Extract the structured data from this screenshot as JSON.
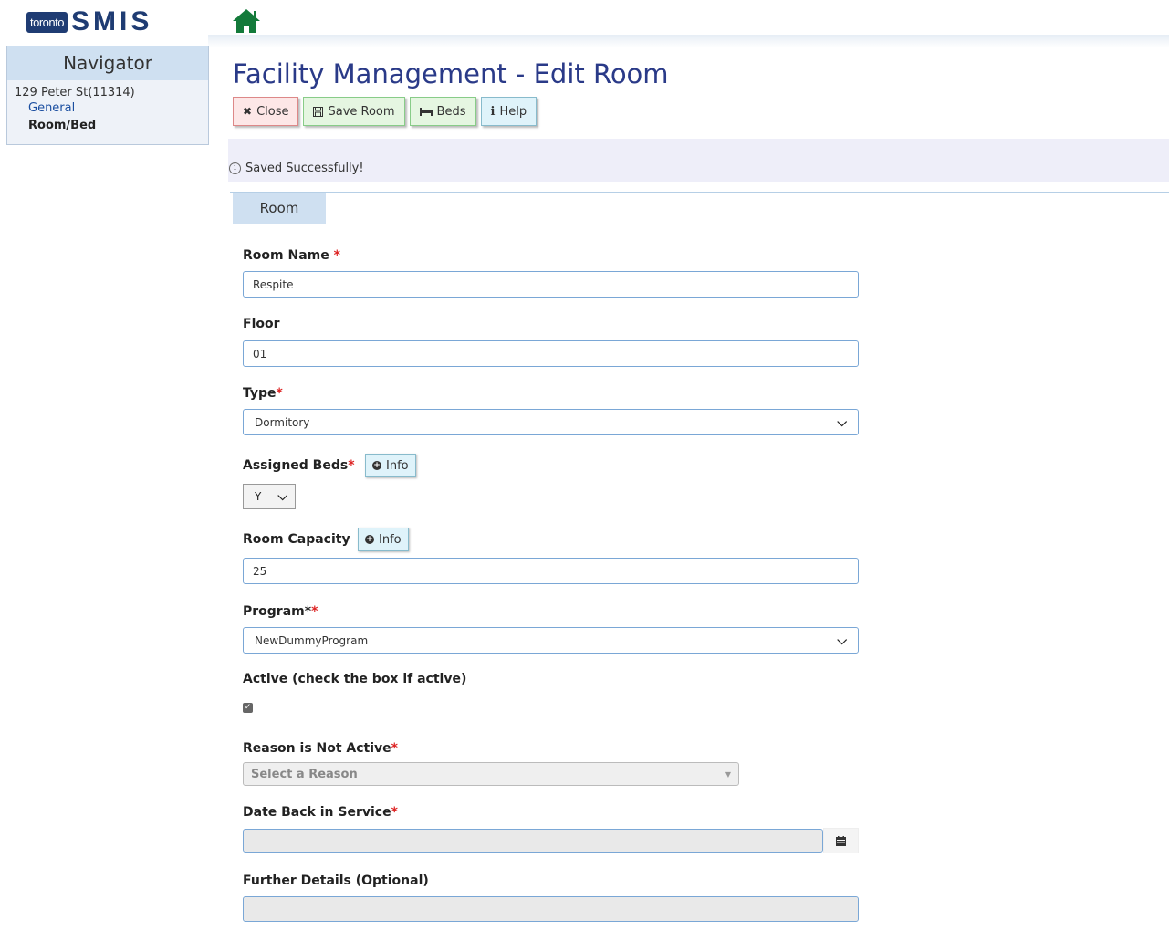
{
  "header": {
    "logo_city": "toronto",
    "logo_app": "SMIS",
    "home_icon": "home-icon",
    "brand_color": "#1f3c73"
  },
  "navigator": {
    "title": "Navigator",
    "facility": "129 Peter St(11314)",
    "items": [
      {
        "label": "General",
        "active": false
      },
      {
        "label": "Room/Bed",
        "active": true
      }
    ]
  },
  "page": {
    "title": "Facility Management - Edit Room"
  },
  "toolbar": {
    "close_label": "Close",
    "save_label": "Save Room",
    "beds_label": "Beds",
    "help_label": "Help"
  },
  "message": {
    "text": "Saved Successfully!"
  },
  "tabs": [
    {
      "label": "Room",
      "active": true
    }
  ],
  "form": {
    "room_name": {
      "label": "Room Name",
      "required_mark": "*",
      "value": "Respite"
    },
    "floor": {
      "label": "Floor",
      "value": "01"
    },
    "type": {
      "label": "Type",
      "required_mark": "*",
      "value": "Dormitory"
    },
    "assigned_beds": {
      "label": "Assigned Beds",
      "required_mark": "*",
      "info_label": "Info",
      "value": "Y"
    },
    "room_capacity": {
      "label": "Room Capacity",
      "info_label": "Info",
      "value": "25"
    },
    "program": {
      "label": "Program*",
      "required_mark": "*",
      "value": "NewDummyProgram"
    },
    "active": {
      "label": "Active (check the box if active)",
      "checked": true
    },
    "reason_not_active": {
      "label": "Reason is Not Active",
      "required_mark": "*",
      "placeholder": "Select a Reason"
    },
    "date_back": {
      "label": "Date Back in Service",
      "required_mark": "*",
      "value": ""
    },
    "further_details": {
      "label": "Further Details (Optional)",
      "value": ""
    }
  }
}
